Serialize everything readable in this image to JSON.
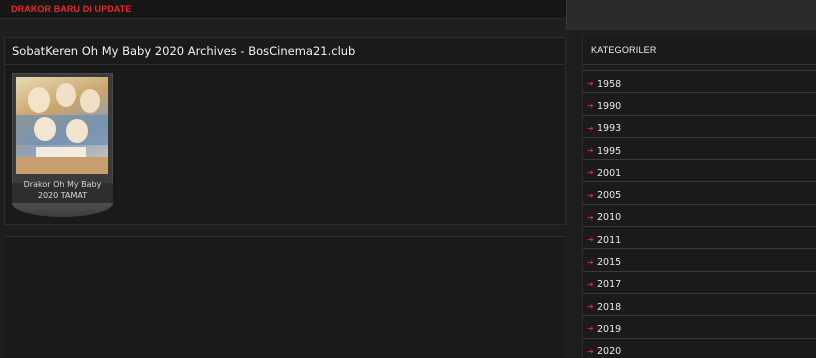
{
  "topbar": {
    "ticker": "DRAKOR BARU DI UPDATE"
  },
  "archive": {
    "heading": "SobatKeren Oh My Baby 2020 Archives - BosCinema21.club",
    "items": [
      {
        "caption_line1": "Drakor Oh My Baby",
        "caption_line2": "2020 TAMAT"
      }
    ]
  },
  "sidebar": {
    "title": "KATEGORILER",
    "arrow_icon": "right-arrow-icon",
    "accent_color": "#d42a2a",
    "categories": [
      "1958",
      "1990",
      "1993",
      "1995",
      "2001",
      "2005",
      "2010",
      "2011",
      "2015",
      "2017",
      "2018",
      "2019",
      "2020"
    ]
  }
}
